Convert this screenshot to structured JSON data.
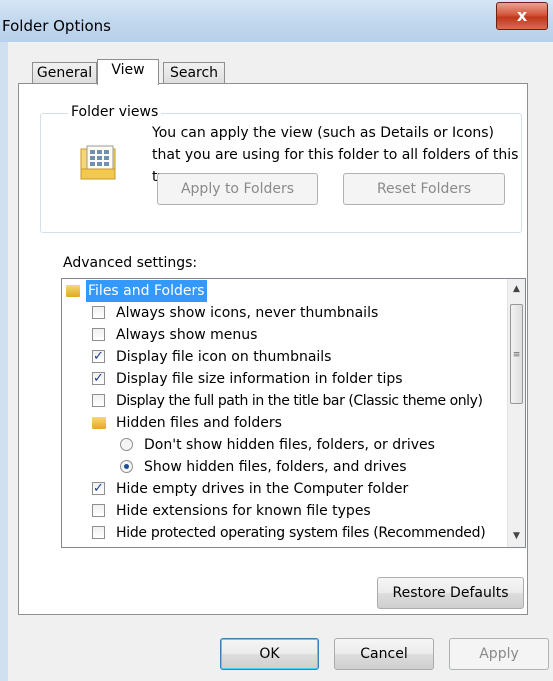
{
  "window": {
    "title": "Folder Options",
    "close_glyph": "x"
  },
  "tabs": [
    {
      "label": "General"
    },
    {
      "label": "View"
    },
    {
      "label": "Search"
    }
  ],
  "folder_views": {
    "label": "Folder views",
    "description": "You can apply the view (such as Details or Icons) that you are using for this folder to all folders of this type.",
    "apply_button": "Apply to Folders",
    "reset_button": "Reset Folders",
    "icon": "folder-view-icon"
  },
  "advanced": {
    "label": "Advanced settings:",
    "items": [
      {
        "type": "folder",
        "label": "Files and Folders",
        "selected": true
      },
      {
        "type": "checkbox",
        "label": "Always show icons, never thumbnails",
        "checked": false
      },
      {
        "type": "checkbox",
        "label": "Always show menus",
        "checked": false
      },
      {
        "type": "checkbox",
        "label": "Display file icon on thumbnails",
        "checked": true
      },
      {
        "type": "checkbox",
        "label": "Display file size information in folder tips",
        "checked": true
      },
      {
        "type": "checkbox",
        "label": "Display the full path in the title bar (Classic theme only)",
        "checked": false
      },
      {
        "type": "folder",
        "label": "Hidden files and folders",
        "selected": false
      },
      {
        "type": "radio",
        "label": "Don't show hidden files, folders, or drives",
        "checked": false
      },
      {
        "type": "radio",
        "label": "Show hidden files, folders, and drives",
        "checked": true
      },
      {
        "type": "checkbox",
        "label": "Hide empty drives in the Computer folder",
        "checked": true
      },
      {
        "type": "checkbox",
        "label": "Hide extensions for known file types",
        "checked": false
      },
      {
        "type": "checkbox",
        "label": "Hide protected operating system files (Recommended)",
        "checked": false
      }
    ],
    "scrollbar": {
      "up": "▲",
      "down": "▼",
      "grip": "≡"
    }
  },
  "restore_button": "Restore Defaults",
  "footer": {
    "ok": "OK",
    "cancel": "Cancel",
    "apply": "Apply"
  }
}
